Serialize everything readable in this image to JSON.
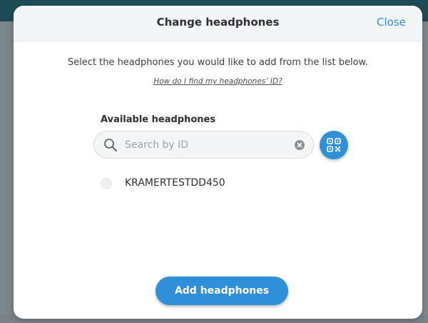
{
  "background": {
    "header_color": "#1f4b57",
    "overlay_color": "#7d858b"
  },
  "modal": {
    "title": "Change headphones",
    "close_label": "Close",
    "instruction": "Select the headphones you would like to add from the list below.",
    "help_link": "How do I find my headphones’ ID?",
    "section_label": "Available headphones",
    "search": {
      "placeholder": "Search by ID",
      "value": "",
      "icon": "search-icon",
      "clear_icon": "clear-icon"
    },
    "qr_button": {
      "icon": "qr-code-icon"
    },
    "headphones": [
      {
        "id": "KRAMERTESTDD450",
        "selected": false
      }
    ],
    "add_button_label": "Add headphones"
  },
  "colors": {
    "accent": "#2f8fd8",
    "title_text": "#2b2f33",
    "header_background": "#f4f5f6"
  }
}
